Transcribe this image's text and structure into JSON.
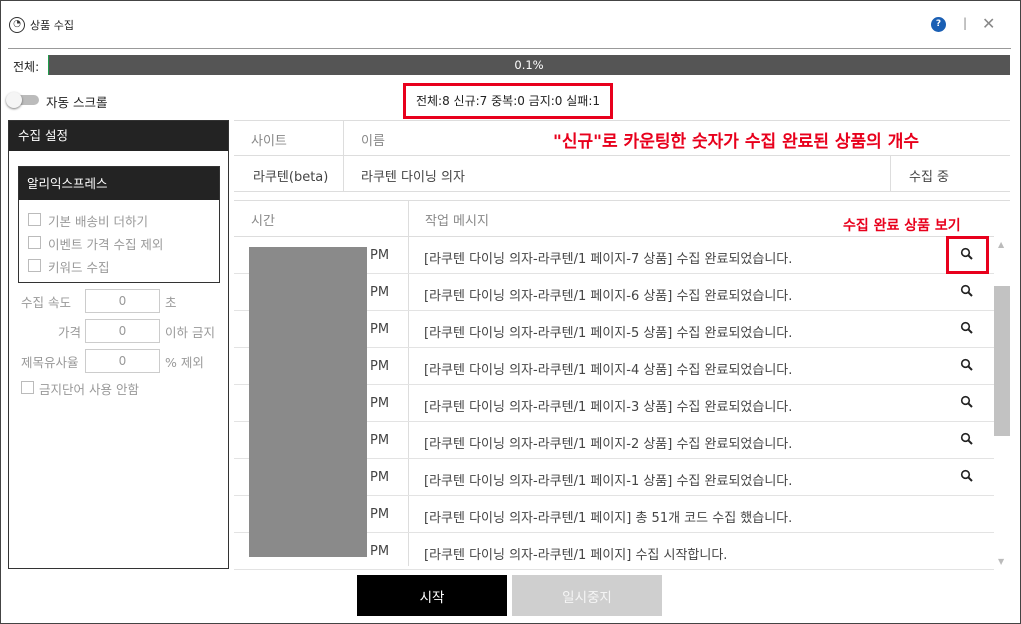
{
  "window": {
    "app_icon": "app-logo-icon",
    "title": "상품 수집",
    "help_icon_text": "?",
    "separator": "|",
    "close_icon": "✕"
  },
  "progress": {
    "label": "전체:",
    "value_percent": 0.1,
    "text": "0.1%",
    "fill_color": "#1f9e4b"
  },
  "auto_scroll": {
    "label": "자동 스크롤",
    "enabled": false
  },
  "stats": {
    "text": "전체:8 신규:7 중복:0 금지:0 실패:1"
  },
  "settings_panel": {
    "header": "수집 설정",
    "aliexpress": {
      "header": "알리익스프레스",
      "options": [
        {
          "label": "기본 배송비 더하기",
          "checked": false
        },
        {
          "label": "이벤트 가격 수집 제외",
          "checked": false
        },
        {
          "label": "키워드 수집",
          "checked": false
        }
      ]
    },
    "speed": {
      "label": "수집 속도",
      "value": "0",
      "unit": "초"
    },
    "price": {
      "label": "가격",
      "value": "0",
      "unit": "이하 금지"
    },
    "title_similarity": {
      "label": "제목유사율",
      "value": "0",
      "unit": "% 제외"
    },
    "banned_words": {
      "label": "금지단어 사용 안함",
      "checked": false
    }
  },
  "site_table": {
    "headers": {
      "site": "사이트",
      "name": "이름"
    },
    "row": {
      "site": "라쿠텐(beta)",
      "name": "라쿠텐 다이닝 의자",
      "status": "수집 중"
    }
  },
  "annotations": {
    "count_note": "\"신규\"로 카운팅한 숫자가 수집 완료된 상품의 개수",
    "view_note": "수집 완료 상품 보기",
    "color": "#e8001c"
  },
  "log_table": {
    "headers": {
      "time": "시간",
      "message": "작업 메시지"
    },
    "rows": [
      {
        "time": "PM",
        "message": "[라쿠텐 다이닝 의자-라쿠텐/1 페이지-7 상품] 수집 완료되었습니다.",
        "has_search": true
      },
      {
        "time": "PM",
        "message": "[라쿠텐 다이닝 의자-라쿠텐/1 페이지-6 상품] 수집 완료되었습니다.",
        "has_search": true
      },
      {
        "time": "PM",
        "message": "[라쿠텐 다이닝 의자-라쿠텐/1 페이지-5 상품] 수집 완료되었습니다.",
        "has_search": true
      },
      {
        "time": "PM",
        "message": "[라쿠텐 다이닝 의자-라쿠텐/1 페이지-4 상품] 수집 완료되었습니다.",
        "has_search": true
      },
      {
        "time": "PM",
        "message": "[라쿠텐 다이닝 의자-라쿠텐/1 페이지-3 상품] 수집 완료되었습니다.",
        "has_search": true
      },
      {
        "time": "PM",
        "message": "[라쿠텐 다이닝 의자-라쿠텐/1 페이지-2 상품] 수집 완료되었습니다.",
        "has_search": true
      },
      {
        "time": "PM",
        "message": "[라쿠텐 다이닝 의자-라쿠텐/1 페이지-1 상품] 수집 완료되었습니다.",
        "has_search": true
      },
      {
        "time": "PM",
        "message": "[라쿠텐 다이닝 의자-라쿠텐/1 페이지] 총 51개 코드 수집 했습니다.",
        "has_search": false
      },
      {
        "time": "PM",
        "message": "[라쿠텐 다이닝 의자-라쿠텐/1 페이지] 수집 시작합니다.",
        "has_search": false
      }
    ]
  },
  "buttons": {
    "start": "시작",
    "pause": "일시중지"
  }
}
